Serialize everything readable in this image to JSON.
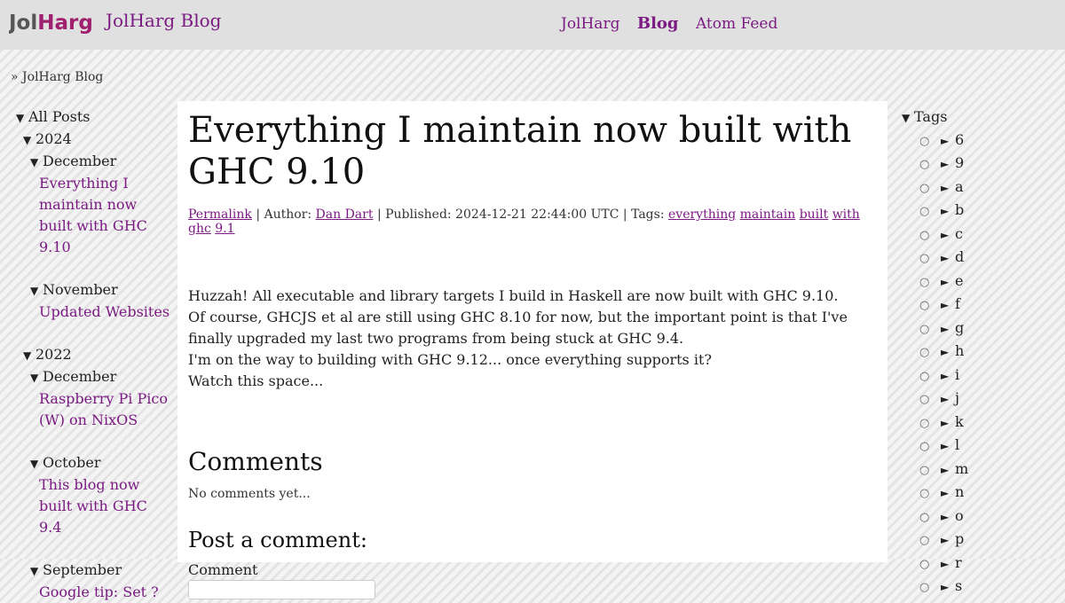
{
  "site": {
    "logo_text": "JolHarg",
    "title": "JolHarg Blog",
    "nav": [
      {
        "label": "JolHarg",
        "active": false
      },
      {
        "label": "Blog",
        "active": true
      },
      {
        "label": "Atom Feed",
        "active": false
      }
    ],
    "breadcrumb": {
      "sep": "»",
      "label": "JolHarg Blog"
    }
  },
  "archive": {
    "root": "All Posts",
    "years": [
      {
        "year": "2024",
        "months": [
          {
            "month": "December",
            "posts": [
              "Everything I maintain now built with GHC 9.10"
            ]
          },
          {
            "month": "November",
            "posts": [
              "Updated Websites"
            ]
          }
        ]
      },
      {
        "year": "2022",
        "months": [
          {
            "month": "December",
            "posts": [
              "Raspberry Pi Pico (W) on NixOS"
            ]
          },
          {
            "month": "October",
            "posts": [
              "This blog now built with GHC 9.4"
            ]
          },
          {
            "month": "September",
            "posts": [
              "Google tip: Set ?"
            ]
          }
        ]
      }
    ]
  },
  "post": {
    "title": "Everything I maintain now built with GHC 9.10",
    "permalink": "Permalink",
    "author_label": "Author:",
    "author": "Dan Dart",
    "published_label": "Published:",
    "published": "2024-12-21 22:44:00 UTC",
    "tags_label": "Tags:",
    "tags": [
      "everything",
      "maintain",
      "built",
      "with",
      "ghc",
      "9.1"
    ],
    "paragraphs": [
      "Huzzah! All executable and library targets I build in Haskell are now built with GHC 9.10.",
      "Of course, GHCJS et al are still using GHC 8.10 for now, but the important point is that I've finally upgraded my last two programs from being stuck at GHC 9.4.",
      "I'm on the way to building with GHC 9.12... once everything supports it?",
      "Watch this space..."
    ]
  },
  "comments": {
    "heading": "Comments",
    "empty": "No comments yet...",
    "form_heading": "Post a comment:",
    "field_label": "Comment"
  },
  "tags_panel": {
    "heading": "Tags",
    "letters": [
      "6",
      "9",
      "a",
      "b",
      "c",
      "d",
      "e",
      "f",
      "g",
      "h",
      "i",
      "j",
      "k",
      "l",
      "m",
      "n",
      "o",
      "p",
      "r",
      "s"
    ]
  },
  "colors": {
    "accent": "#7a1a82",
    "logo_dark": "#555555",
    "logo_accent": "#a02070"
  }
}
